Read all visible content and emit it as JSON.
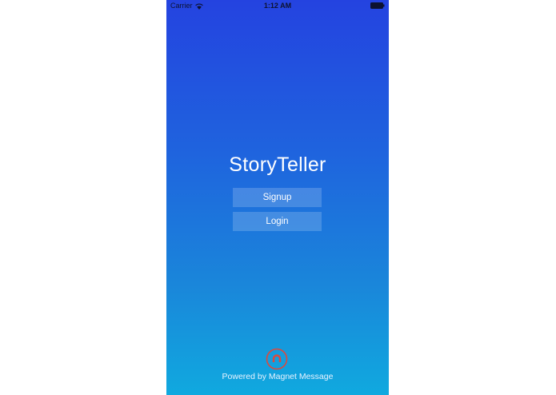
{
  "status_bar": {
    "carrier": "Carrier",
    "time": "1:12 AM",
    "wifi_icon": "wifi-icon",
    "battery_icon": "battery-icon"
  },
  "app": {
    "title": "StoryTeller"
  },
  "actions": {
    "signup_label": "Signup",
    "login_label": "Login"
  },
  "footer": {
    "logo_icon": "magnet-icon",
    "powered_by": "Powered by Magnet Message"
  },
  "colors": {
    "gradient_top": "#2443e0",
    "gradient_bottom": "#10a9df",
    "button_fill": "rgba(255,255,255,0.18)",
    "logo_red": "#e0483a"
  }
}
